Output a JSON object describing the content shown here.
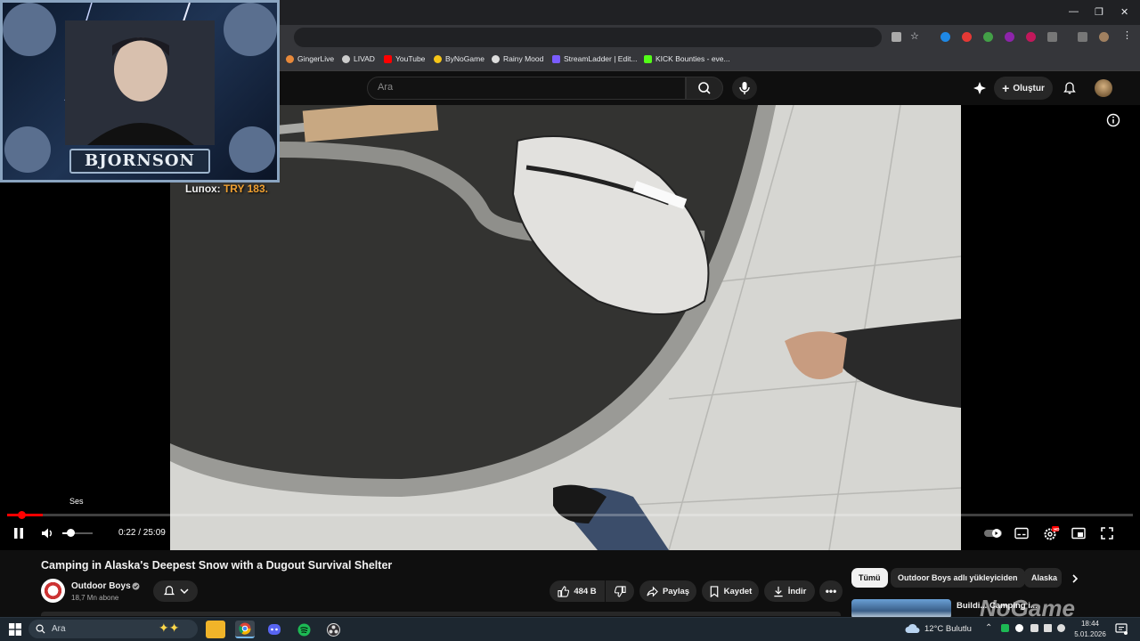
{
  "browser": {
    "window_controls": {
      "minimize": "—",
      "restore": "❐",
      "close": "✕"
    },
    "bookmarks": [
      {
        "label": "GingerLive",
        "color": "#e8893a"
      },
      {
        "label": "LIVAD",
        "color": "#cccccc"
      },
      {
        "label": "YouTube",
        "color": "#ff0000"
      },
      {
        "label": "ByNoGame",
        "color": "#f5c518"
      },
      {
        "label": "Rainy Mood",
        "color": "#dddddd"
      },
      {
        "label": "StreamLadder | Edit...",
        "color": "#7a5cff"
      },
      {
        "label": "KICK Bounties - eve...",
        "color": "#53fc18"
      }
    ]
  },
  "youtube": {
    "search": {
      "placeholder": "Ara"
    },
    "create_label": "Oluştur"
  },
  "overlay": {
    "donation_name": "Luпох:",
    "donation_amount": "TRY 183.",
    "streamer_name": "BJORNSON"
  },
  "player": {
    "progress_fraction": 0.0147,
    "volume_fraction": 0.25,
    "volume_tooltip": "Ses",
    "time": "0:22 / 25:09",
    "hd_badge": "HD"
  },
  "video_info": {
    "title": "Camping in Alaska's Deepest Snow with a Dugout Survival Shelter",
    "channel": "Outdoor Boys",
    "subscribers": "18,7 Mn abone",
    "likes": "484 B",
    "share": "Paylaş",
    "save": "Kaydet",
    "download": "İndir"
  },
  "chips": [
    "Tümü",
    "Outdoor Boys adlı yükleyiciden",
    "Alaska"
  ],
  "recommendation": {
    "title_partial": "Buildi... Camping i..."
  },
  "watermark": "NoGame",
  "taskbar": {
    "search_placeholder": "Ara",
    "weather": "12°C  Bulutlu",
    "time": "18:44",
    "date": "5.01.2026"
  }
}
